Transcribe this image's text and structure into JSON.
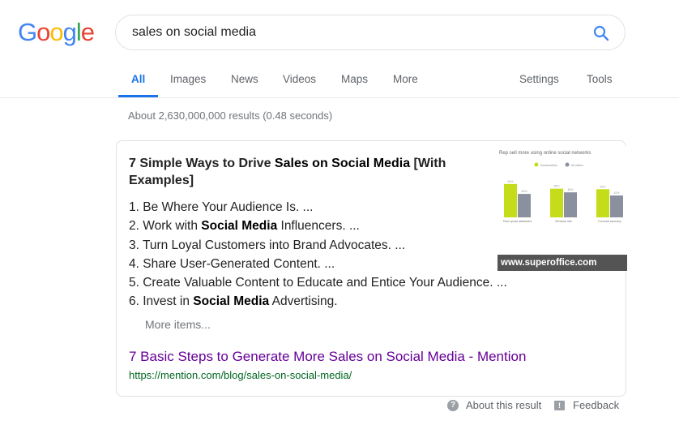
{
  "logo": {
    "letters": [
      {
        "char": "G",
        "color": "#4285F4"
      },
      {
        "char": "o",
        "color": "#EA4335"
      },
      {
        "char": "o",
        "color": "#FBBC05"
      },
      {
        "char": "g",
        "color": "#4285F4"
      },
      {
        "char": "l",
        "color": "#34A853"
      },
      {
        "char": "e",
        "color": "#EA4335"
      }
    ]
  },
  "search": {
    "query": "sales on social media",
    "icon": "search-icon",
    "accent": "#4285F4"
  },
  "tabs": {
    "items": [
      {
        "label": "All",
        "active": true
      },
      {
        "label": "Images",
        "active": false
      },
      {
        "label": "News",
        "active": false
      },
      {
        "label": "Videos",
        "active": false
      },
      {
        "label": "Maps",
        "active": false
      },
      {
        "label": "More",
        "active": false
      }
    ],
    "settings": "Settings",
    "tools": "Tools"
  },
  "result_stats": "About 2,630,000,000 results (0.48 seconds)",
  "featured_snippet": {
    "title_parts": {
      "a": "7 Simple Ways to Drive ",
      "b": "Sales on Social Media",
      "c": " [With Examples]"
    },
    "list": [
      {
        "num": "1. ",
        "pre": "Be Where Your Audience Is. ...",
        "bold": "",
        "post": ""
      },
      {
        "num": "2. ",
        "pre": "Work with ",
        "bold": "Social Media",
        "post": " Influencers. ..."
      },
      {
        "num": "3. ",
        "pre": "Turn Loyal Customers into Brand Advocates. ...",
        "bold": "",
        "post": ""
      },
      {
        "num": "4. ",
        "pre": "Share User-Generated Content. ...",
        "bold": "",
        "post": ""
      },
      {
        "num": "5. ",
        "pre": "Create Valuable Content to Educate and Entice Your Audience. ...",
        "bold": "",
        "post": ""
      },
      {
        "num": "6. ",
        "pre": "Invest in ",
        "bold": "Social Media",
        "post": " Advertising."
      }
    ],
    "more_items": "More items...",
    "thumbnail": {
      "source": "www.superoffice.com",
      "chart_title": "Rep sell more using online social networks",
      "legend": [
        {
          "label": "Social sellers",
          "color": "#c5dc1a"
        },
        {
          "label": "All others",
          "color": "#8a909e"
        }
      ],
      "categories": [
        "Team quota attainment",
        "Renewal rate",
        "Forecast accuracy"
      ],
      "series": [
        {
          "name": "Social sellers",
          "values": [
            64,
            55,
            54
          ]
        },
        {
          "name": "All others",
          "values": [
            45,
            48,
            42
          ]
        }
      ]
    },
    "link_title": "7 Basic Steps to Generate More Sales on Social Media - Mention",
    "link_url": "https://mention.com/blog/sales-on-social-media/"
  },
  "footer": {
    "about": "About this result",
    "feedback": "Feedback"
  }
}
